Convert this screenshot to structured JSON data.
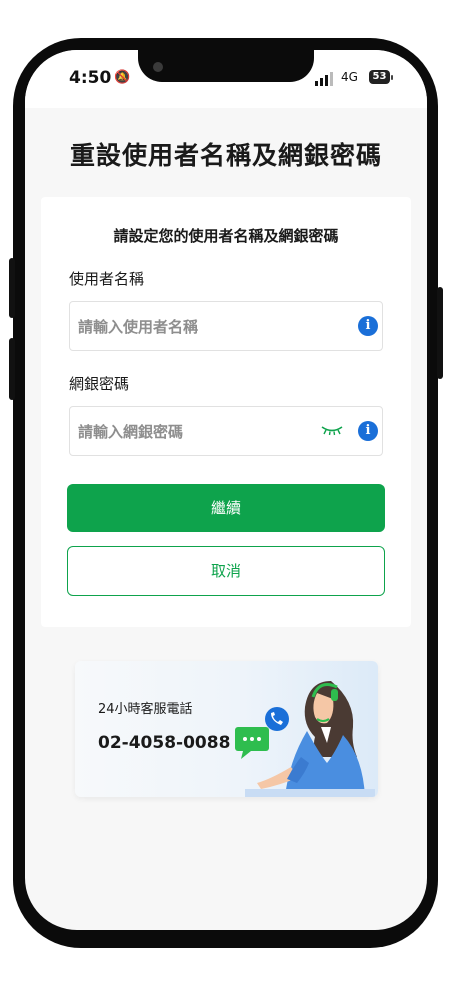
{
  "status_bar": {
    "time": "4:50",
    "network": "4G",
    "battery": "53"
  },
  "page": {
    "title": "重設使用者名稱及網銀密碼"
  },
  "form": {
    "heading": "請設定您的使用者名稱及網銀密碼",
    "username": {
      "label": "使用者名稱",
      "placeholder": "請輸入使用者名稱"
    },
    "password": {
      "label": "網銀密碼",
      "placeholder": "請輸入網銀密碼"
    },
    "continue_label": "繼續",
    "cancel_label": "取消"
  },
  "support": {
    "label": "24小時客服電話",
    "phone": "02-4058-0088"
  },
  "colors": {
    "primary": "#0ea34c",
    "info": "#1a6fd8",
    "chat_green": "#2ebd4e",
    "agent_blue": "#4a8ee0"
  }
}
